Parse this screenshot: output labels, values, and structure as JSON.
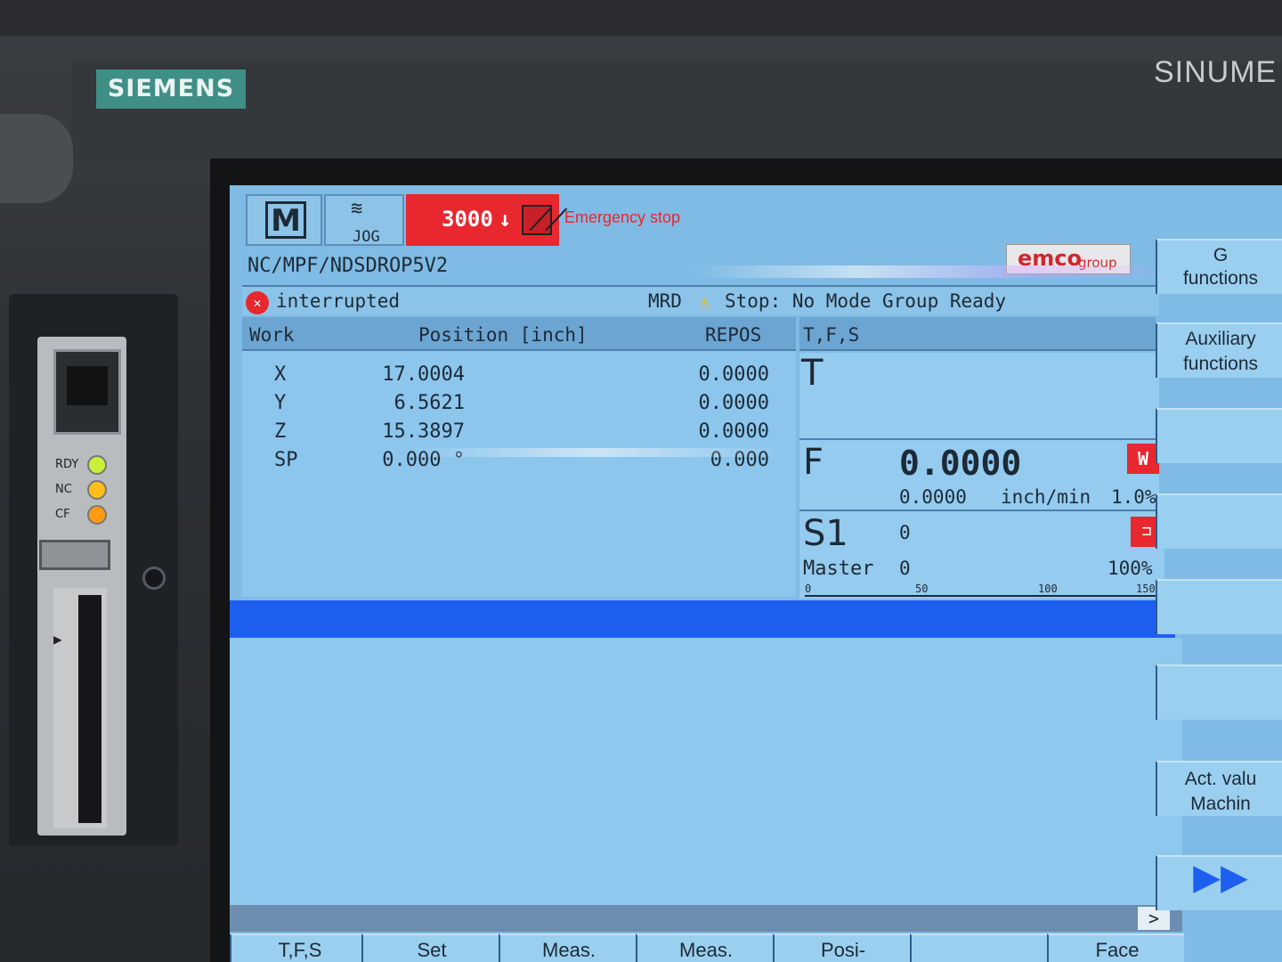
{
  "bezel": {
    "brand": "SIEMENS",
    "brand_right": "SINUME",
    "leds": [
      {
        "label": "RDY",
        "color": "#c8f23a"
      },
      {
        "label": "NC",
        "color": "#ffbe1a"
      },
      {
        "label": "CF",
        "color": "#ff9a14"
      }
    ]
  },
  "header": {
    "mode_icon": "M",
    "jog_label": "JOG",
    "alarm_number": "3000",
    "alarm_text": "Emergency stop",
    "alarm_color": "#e8272f"
  },
  "program": {
    "path": "NC/MPF/NDSDROP5V2",
    "logo_main": "emco",
    "logo_sub": "group",
    "state": "interrupted",
    "mrd": "MRD",
    "message": "Stop: No Mode Group Ready"
  },
  "axes": {
    "headers": {
      "work": "Work",
      "position": "Position [inch]",
      "repos": "REPOS"
    },
    "rows": [
      {
        "name": "X",
        "position": "17.0004",
        "repos": "0.0000"
      },
      {
        "name": "Y",
        "position": "6.5621",
        "repos": "0.0000"
      },
      {
        "name": "Z",
        "position": "15.3897",
        "repos": "0.0000"
      },
      {
        "name": "SP",
        "position": "0.000 °",
        "repos": "0.000"
      }
    ]
  },
  "tfs": {
    "title": "T,F,S",
    "t_label": "T",
    "f_label": "F",
    "f_value": "0.0000",
    "f_actual": "0.0000",
    "f_unit": "inch/min",
    "f_override": "1.0%",
    "s_label": "S1",
    "s_value": "0",
    "master_label": "Master",
    "master_value": "0",
    "s_override": "100%",
    "scale_ticks": [
      "0",
      "50",
      "100",
      "150"
    ]
  },
  "softkeys_vertical": [
    {
      "label": "G\nfunctions"
    },
    {
      "label": "Auxiliary\nfunctions"
    },
    {
      "label": ""
    },
    {
      "label": ""
    },
    {
      "label": ""
    },
    {
      "label": ""
    },
    {
      "label": "Act. valu\nMachin"
    },
    {
      "label": "▶▶"
    }
  ],
  "softkeys_horizontal": [
    {
      "label": "T,F,S"
    },
    {
      "label": "Set"
    },
    {
      "label": "Meas."
    },
    {
      "label": "Meas."
    },
    {
      "label": "Posi-"
    },
    {
      "label": ""
    },
    {
      "label": "Face"
    }
  ],
  "scroll_more": ">"
}
